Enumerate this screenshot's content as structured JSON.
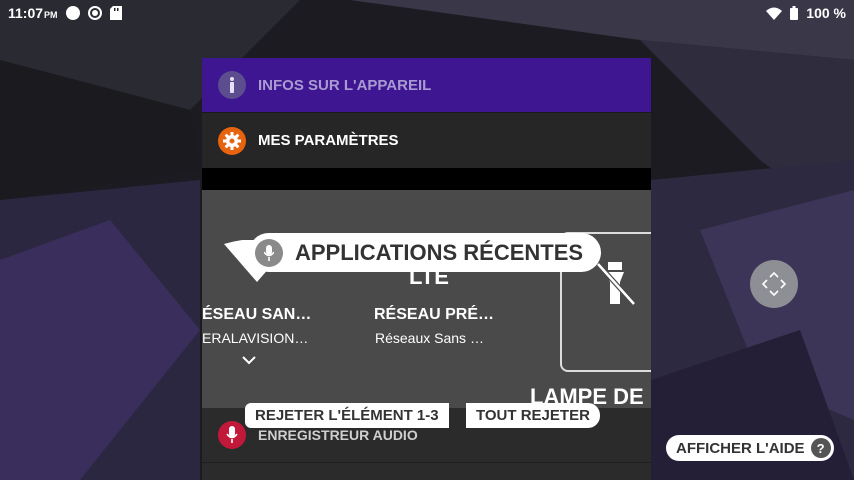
{
  "status_bar": {
    "time": "11:07",
    "ampm": "PM",
    "battery": "100 %",
    "icons": [
      "circle-icon",
      "radio-icon",
      "sd-card-icon",
      "wifi-icon",
      "battery-icon"
    ]
  },
  "recents": {
    "cards": [
      {
        "label": "INFOS SUR L'APPAREIL",
        "icon": "info-icon"
      },
      {
        "label": "MES PARAMÈTRES",
        "icon": "gear-icon"
      }
    ],
    "tiles": [
      {
        "title": "ÉSEAU SAN…",
        "subtitle": "ERALAVISION…"
      },
      {
        "title": "RÉSEAU PRÉ…",
        "subtitle": "Réseaux Sans …"
      },
      {
        "title": "LTE",
        "subtitle": ""
      }
    ],
    "lamp_label": "LAMPE DE",
    "audio_card": {
      "label": "ENREGISTREUR AUDIO",
      "icon": "mic-icon"
    }
  },
  "voice_access": {
    "recent_apps_label": "APPLICATIONS RÉCENTES",
    "reject_item_label": "REJETER L'ÉLÉMENT 1-3",
    "reject_all_label": "TOUT REJETER",
    "help_label": "AFFICHER L'AIDE",
    "help_glyph": "?"
  },
  "colors": {
    "info_card": "#3f1691",
    "settings_icon": "#e8630e",
    "audio_icon": "#c2193b"
  }
}
